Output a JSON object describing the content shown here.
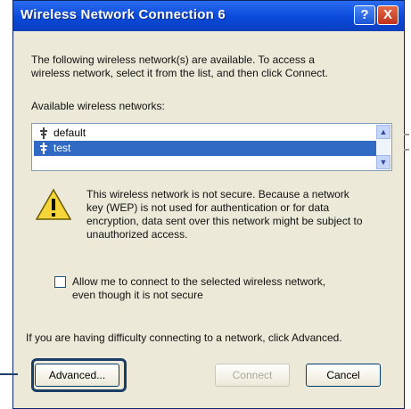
{
  "window": {
    "title": "Wireless Network Connection 6"
  },
  "titlebar_buttons": {
    "help": "?",
    "close": "X"
  },
  "intro_line1": "The following wireless network(s) are available. To access a",
  "intro_line2": "wireless network, select it from the list, and then click Connect.",
  "networks_label": "Available wireless networks:",
  "networks": [
    {
      "name": "default",
      "selected": false
    },
    {
      "name": "test",
      "selected": true
    }
  ],
  "warning_lines": [
    "This wireless network is not secure. Because a network",
    "key (WEP) is not used for authentication or for data",
    "encryption, data sent over this network might be subject to",
    "unauthorized access."
  ],
  "allow_line1": "Allow me to connect to the selected wireless network,",
  "allow_line2": "even though it is not secure",
  "allow_checked": false,
  "help_text": "If you are having difficulty connecting to a network, click Advanced.",
  "buttons": {
    "advanced": "Advanced...",
    "connect": "Connect",
    "cancel": "Cancel"
  },
  "colors": {
    "titlebar": "#0a49d9",
    "selection": "#316ac5",
    "highlight_frame": "#1b3e66"
  },
  "icons": {
    "warning": "warning-icon",
    "signal": "signal-strength-icon"
  }
}
